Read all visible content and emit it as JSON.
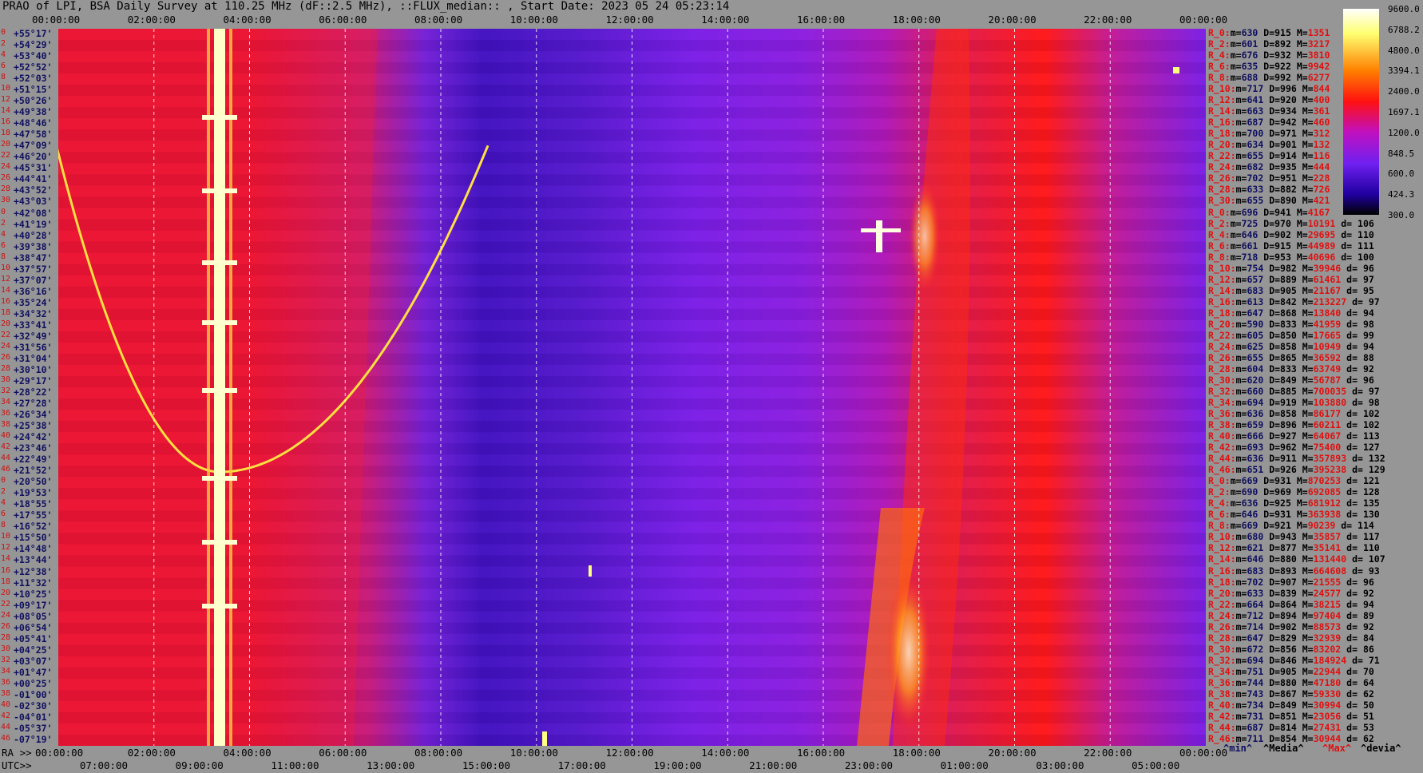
{
  "title": "PRAO of LPI, BSA Daily Survey at 110.25 MHz (dF::2.5 MHz), ::FLUX_median:: , Start Date: 2023 05 24 05:23:14",
  "top_ticks": [
    "00:00:00",
    "02:00:00",
    "04:00:00",
    "06:00:00",
    "08:00:00",
    "10:00:00",
    "12:00:00",
    "14:00:00",
    "16:00:00",
    "18:00:00",
    "20:00:00",
    "22:00:00",
    "00:00:00"
  ],
  "bottom_label_ra": "RA >>",
  "bottom_label_utc": "UTC>>",
  "ra_ticks": [
    "00:00:00",
    "02:00:00",
    "04:00:00",
    "06:00:00",
    "08:00:00",
    "10:00:00",
    "12:00:00",
    "14:00:00",
    "16:00:00",
    "18:00:00",
    "20:00:00",
    "22:00:00",
    "00:00:00"
  ],
  "utc_ticks": [
    "07:00:00",
    "09:00:00",
    "11:00:00",
    "13:00:00",
    "15:00:00",
    "17:00:00",
    "19:00:00",
    "21:00:00",
    "23:00:00",
    "01:00:00",
    "03:00:00",
    "05:00:00"
  ],
  "row_indices": [
    "0",
    "2",
    "4",
    "6",
    "8",
    "10",
    "12",
    "14",
    "16",
    "18",
    "20",
    "22",
    "24",
    "26",
    "28",
    "30",
    "0",
    "2",
    "4",
    "6",
    "8",
    "10",
    "12",
    "14",
    "16",
    "18",
    "20",
    "22",
    "24",
    "26",
    "28",
    "30",
    "32",
    "34",
    "36",
    "38",
    "40",
    "42",
    "44",
    "46",
    "0",
    "2",
    "4",
    "6",
    "8",
    "10",
    "12",
    "14",
    "16",
    "18",
    "20",
    "22",
    "24",
    "26",
    "28",
    "30",
    "32",
    "34",
    "36",
    "38",
    "40",
    "42",
    "44",
    "46"
  ],
  "dec_labels": [
    "+55°17'",
    "+54°29'",
    "+53°40'",
    "+52°52'",
    "+52°03'",
    "+51°15'",
    "+50°26'",
    "+49°38'",
    "+48°46'",
    "+47°58'",
    "+47°09'",
    "+46°20'",
    "+45°31'",
    "+44°41'",
    "+43°52'",
    "+43°03'",
    "+42°08'",
    "+41°19'",
    "+40°28'",
    "+39°38'",
    "+38°47'",
    "+37°57'",
    "+37°07'",
    "+36°16'",
    "+35°24'",
    "+34°32'",
    "+33°41'",
    "+32°49'",
    "+31°56'",
    "+31°04'",
    "+30°10'",
    "+29°17'",
    "+28°22'",
    "+27°28'",
    "+26°34'",
    "+25°38'",
    "+24°42'",
    "+23°46'",
    "+22°49'",
    "+21°52'",
    "+20°50'",
    "+19°53'",
    "+18°55'",
    "+17°55'",
    "+16°52'",
    "+15°50'",
    "+14°48'",
    "+13°44'",
    "+12°38'",
    "+11°32'",
    "+10°25'",
    "+09°17'",
    "+08°05'",
    "+06°54'",
    "+05°41'",
    "+04°25'",
    "+03°07'",
    "+01°47'",
    "+00°25'",
    "-01°00'",
    "-02°30'",
    "-04°01'",
    "-05°37'",
    "-07°19'"
  ],
  "stats": [
    {
      "r": "R_0:",
      "min": "630",
      "med": "915",
      "max": "1351",
      "dev": ""
    },
    {
      "r": "R_2:",
      "min": "601",
      "med": "892",
      "max": "3217",
      "dev": ""
    },
    {
      "r": "R_4:",
      "min": "676",
      "med": "932",
      "max": "3810",
      "dev": ""
    },
    {
      "r": "R_6:",
      "min": "635",
      "med": "922",
      "max": "9942",
      "dev": ""
    },
    {
      "r": "R_8:",
      "min": "688",
      "med": "992",
      "max": "6277",
      "dev": ""
    },
    {
      "r": "R_10:",
      "min": "717",
      "med": "996",
      "max": "844",
      "dev": ""
    },
    {
      "r": "R_12:",
      "min": "641",
      "med": "920",
      "max": "400",
      "dev": ""
    },
    {
      "r": "R_14:",
      "min": "663",
      "med": "934",
      "max": "361",
      "dev": ""
    },
    {
      "r": "R_16:",
      "min": "687",
      "med": "942",
      "max": "460",
      "dev": ""
    },
    {
      "r": "R_18:",
      "min": "700",
      "med": "971",
      "max": "312",
      "dev": ""
    },
    {
      "r": "R_20:",
      "min": "634",
      "med": "901",
      "max": "132",
      "dev": ""
    },
    {
      "r": "R_22:",
      "min": "655",
      "med": "914",
      "max": "116",
      "dev": ""
    },
    {
      "r": "R_24:",
      "min": "682",
      "med": "935",
      "max": "444",
      "dev": ""
    },
    {
      "r": "R_26:",
      "min": "702",
      "med": "951",
      "max": "228",
      "dev": ""
    },
    {
      "r": "R_28:",
      "min": "633",
      "med": "882",
      "max": "726",
      "dev": ""
    },
    {
      "r": "R_30:",
      "min": "655",
      "med": "890",
      "max": "421",
      "dev": ""
    },
    {
      "r": "R_0:",
      "min": "696",
      "med": "941",
      "max": "4167",
      "dev": ""
    },
    {
      "r": "R_2:",
      "min": "725",
      "med": "970",
      "max": "10191",
      "dev": "106"
    },
    {
      "r": "R_4:",
      "min": "646",
      "med": "902",
      "max": "29695",
      "dev": "110"
    },
    {
      "r": "R_6:",
      "min": "661",
      "med": "915",
      "max": "44989",
      "dev": "111"
    },
    {
      "r": "R_8:",
      "min": "718",
      "med": "953",
      "max": "40696",
      "dev": "100"
    },
    {
      "r": "R_10:",
      "min": "754",
      "med": "982",
      "max": "39946",
      "dev": "96"
    },
    {
      "r": "R_12:",
      "min": "657",
      "med": "889",
      "max": "61461",
      "dev": "97"
    },
    {
      "r": "R_14:",
      "min": "683",
      "med": "905",
      "max": "21167",
      "dev": "95"
    },
    {
      "r": "R_16:",
      "min": "613",
      "med": "842",
      "max": "213227",
      "dev": "97"
    },
    {
      "r": "R_18:",
      "min": "647",
      "med": "868",
      "max": "13840",
      "dev": "94"
    },
    {
      "r": "R_20:",
      "min": "590",
      "med": "833",
      "max": "41959",
      "dev": "98"
    },
    {
      "r": "R_22:",
      "min": "605",
      "med": "850",
      "max": "17665",
      "dev": "99"
    },
    {
      "r": "R_24:",
      "min": "625",
      "med": "858",
      "max": "10949",
      "dev": "94"
    },
    {
      "r": "R_26:",
      "min": "655",
      "med": "865",
      "max": "36592",
      "dev": "88"
    },
    {
      "r": "R_28:",
      "min": "604",
      "med": "833",
      "max": "63749",
      "dev": "92"
    },
    {
      "r": "R_30:",
      "min": "620",
      "med": "849",
      "max": "56787",
      "dev": "96"
    },
    {
      "r": "R_32:",
      "min": "660",
      "med": "885",
      "max": "700035",
      "dev": "97"
    },
    {
      "r": "R_34:",
      "min": "694",
      "med": "919",
      "max": "103880",
      "dev": "98"
    },
    {
      "r": "R_36:",
      "min": "636",
      "med": "858",
      "max": "86177",
      "dev": "102"
    },
    {
      "r": "R_38:",
      "min": "659",
      "med": "896",
      "max": "60211",
      "dev": "102"
    },
    {
      "r": "R_40:",
      "min": "666",
      "med": "927",
      "max": "64067",
      "dev": "113"
    },
    {
      "r": "R_42:",
      "min": "693",
      "med": "962",
      "max": "75400",
      "dev": "127"
    },
    {
      "r": "R_44:",
      "min": "636",
      "med": "911",
      "max": "357893",
      "dev": "132"
    },
    {
      "r": "R_46:",
      "min": "651",
      "med": "926",
      "max": "395238",
      "dev": "129"
    },
    {
      "r": "R_0:",
      "min": "669",
      "med": "931",
      "max": "870253",
      "dev": "121"
    },
    {
      "r": "R_2:",
      "min": "690",
      "med": "969",
      "max": "692085",
      "dev": "128"
    },
    {
      "r": "R_4:",
      "min": "636",
      "med": "925",
      "max": "681912",
      "dev": "135"
    },
    {
      "r": "R_6:",
      "min": "646",
      "med": "931",
      "max": "363938",
      "dev": "130"
    },
    {
      "r": "R_8:",
      "min": "669",
      "med": "921",
      "max": "90239",
      "dev": "114"
    },
    {
      "r": "R_10:",
      "min": "680",
      "med": "943",
      "max": "35857",
      "dev": "117"
    },
    {
      "r": "R_12:",
      "min": "621",
      "med": "877",
      "max": "35141",
      "dev": "110"
    },
    {
      "r": "R_14:",
      "min": "646",
      "med": "880",
      "max": "131440",
      "dev": "107"
    },
    {
      "r": "R_16:",
      "min": "683",
      "med": "893",
      "max": "664608",
      "dev": "93"
    },
    {
      "r": "R_18:",
      "min": "702",
      "med": "907",
      "max": "21555",
      "dev": "96"
    },
    {
      "r": "R_20:",
      "min": "633",
      "med": "839",
      "max": "24577",
      "dev": "92"
    },
    {
      "r": "R_22:",
      "min": "664",
      "med": "864",
      "max": "38215",
      "dev": "94"
    },
    {
      "r": "R_24:",
      "min": "712",
      "med": "894",
      "max": "97404",
      "dev": "89"
    },
    {
      "r": "R_26:",
      "min": "714",
      "med": "902",
      "max": "88573",
      "dev": "92"
    },
    {
      "r": "R_28:",
      "min": "647",
      "med": "829",
      "max": "32939",
      "dev": "84"
    },
    {
      "r": "R_30:",
      "min": "672",
      "med": "856",
      "max": "83202",
      "dev": "86"
    },
    {
      "r": "R_32:",
      "min": "694",
      "med": "846",
      "max": "184924",
      "dev": "71"
    },
    {
      "r": "R_34:",
      "min": "751",
      "med": "905",
      "max": "22944",
      "dev": "70"
    },
    {
      "r": "R_36:",
      "min": "744",
      "med": "880",
      "max": "47180",
      "dev": "64"
    },
    {
      "r": "R_38:",
      "min": "743",
      "med": "867",
      "max": "59330",
      "dev": "62"
    },
    {
      "r": "R_40:",
      "min": "734",
      "med": "849",
      "max": "30994",
      "dev": "50"
    },
    {
      "r": "R_42:",
      "min": "731",
      "med": "851",
      "max": "23056",
      "dev": "51"
    },
    {
      "r": "R_44:",
      "min": "687",
      "med": "814",
      "max": "27431",
      "dev": "53"
    },
    {
      "r": "R_46:",
      "min": "711",
      "med": "854",
      "max": "30944",
      "dev": "62"
    }
  ],
  "legend": {
    "min": "^min^",
    "med": "^Media^",
    "max": "^Max^",
    "dev": "^devia^"
  },
  "colorbar_labels": [
    "9600.0",
    "6788.2",
    "4800.0",
    "3394.1",
    "2400.0",
    "1697.1",
    "1200.0",
    "848.5",
    "600.0",
    "424.3",
    "300.0"
  ],
  "colors": {
    "background": "#969696",
    "ridge": "#fff4a0",
    "purple": "#7a1ee6",
    "red": "#ff1a1a",
    "dark_blue": "#3a0fb8"
  },
  "chart_data": {
    "type": "heatmap",
    "title": "PRAO of LPI, BSA Daily Survey at 110.25 MHz (dF::2.5 MHz), ::FLUX_median:: , Start Date: 2023 05 24 05:23:14",
    "x_axis_ra": [
      "00:00:00",
      "02:00:00",
      "04:00:00",
      "06:00:00",
      "08:00:00",
      "10:00:00",
      "12:00:00",
      "14:00:00",
      "16:00:00",
      "18:00:00",
      "20:00:00",
      "22:00:00",
      "00:00:00"
    ],
    "x_axis_utc": [
      "07:00:00",
      "09:00:00",
      "11:00:00",
      "13:00:00",
      "15:00:00",
      "17:00:00",
      "19:00:00",
      "21:00:00",
      "23:00:00",
      "01:00:00",
      "03:00:00",
      "05:00:00"
    ],
    "colorbar_range": [
      300.0,
      9600.0
    ],
    "colorbar_scale": "log",
    "n_rows": 64
  }
}
